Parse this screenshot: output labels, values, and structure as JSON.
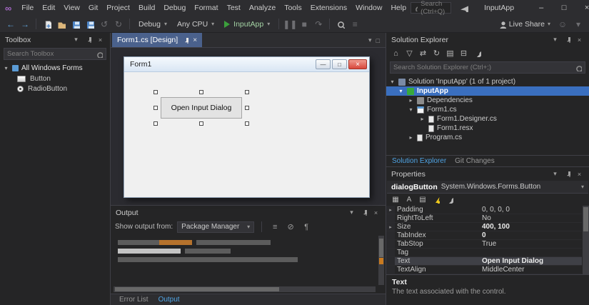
{
  "icons": {
    "minimize": "–",
    "maximize": "□",
    "close": "×",
    "chevron_down": "▾",
    "chevron_right": "▸",
    "back": "←",
    "forward": "→",
    "undo": "↺",
    "redo": "↻",
    "home": "⌂",
    "funnel": "▽",
    "sync": "⇄",
    "refresh": "↻",
    "collapse_all": "⊟",
    "show_all_files": "▤",
    "list": "≡",
    "clear": "⊘",
    "categorized": "▦",
    "alphabetical": "A",
    "properties_page": "▤"
  },
  "titlebar": {
    "menus": [
      "File",
      "Edit",
      "View",
      "Git",
      "Project",
      "Build",
      "Debug",
      "Format",
      "Test",
      "Analyze",
      "Tools",
      "Extensions",
      "Window",
      "Help"
    ],
    "search_placeholder": "Search (Ctrl+Q)",
    "app_title": "InputApp"
  },
  "toolbar": {
    "debug_config": "Debug",
    "platform": "Any CPU",
    "run_target": "InputApp",
    "live_share": "Live Share"
  },
  "toolbox": {
    "title": "Toolbox",
    "search_placeholder": "Search Toolbox",
    "group": "All Windows Forms",
    "items": [
      "Button",
      "RadioButton"
    ]
  },
  "editor": {
    "tab_title": "Form1.cs [Design]",
    "form": {
      "title": "Form1",
      "button_text": "Open Input Dialog"
    }
  },
  "output_panel": {
    "title": "Output",
    "show_output_from": "Show output from:",
    "source": "Package Manager"
  },
  "bottom_tabs": {
    "error_list": "Error List",
    "output": "Output"
  },
  "solution_explorer": {
    "title": "Solution Explorer",
    "search_placeholder": "Search Solution Explorer (Ctrl+;)",
    "tree": {
      "solution": "Solution 'InputApp' (1 of 1 project)",
      "project": "InputApp",
      "dependencies": "Dependencies",
      "form1": "Form1.cs",
      "form1_designer": "Form1.Designer.cs",
      "form1_resx": "Form1.resx",
      "program": "Program.cs"
    },
    "tabs": [
      "Solution Explorer",
      "Git Changes"
    ]
  },
  "properties_panel": {
    "title": "Properties",
    "object_name": "dialogButton",
    "object_type": "System.Windows.Forms.Button",
    "rows": [
      {
        "name": "Padding",
        "value": "0, 0, 0, 0"
      },
      {
        "name": "RightToLeft",
        "value": "No"
      },
      {
        "name": "Size",
        "value": "400, 100"
      },
      {
        "name": "TabIndex",
        "value": "0"
      },
      {
        "name": "TabStop",
        "value": "True"
      },
      {
        "name": "Tag",
        "value": ""
      },
      {
        "name": "Text",
        "value": "Open Input Dialog"
      },
      {
        "name": "TextAlign",
        "value": "MiddleCenter"
      }
    ],
    "description_title": "Text",
    "description_body": "The text associated with the control."
  }
}
